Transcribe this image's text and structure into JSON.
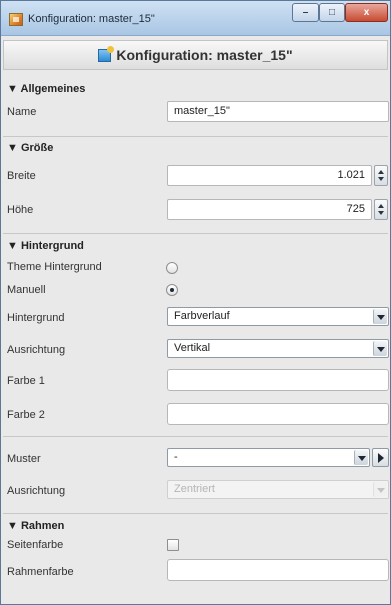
{
  "window": {
    "title": "Konfiguration: master_15\"",
    "buttons": {
      "minimize": "–",
      "maximize": "□",
      "close": "x"
    }
  },
  "panel": {
    "header": "Konfiguration: master_15\""
  },
  "sections": {
    "allgemeines": {
      "title": "▼ Allgemeines",
      "name_label": "Name",
      "name_value": "master_15\""
    },
    "groesse": {
      "title": "▼ Größe",
      "breite_label": "Breite",
      "breite_value": "1.021",
      "hoehe_label": "Höhe",
      "hoehe_value": "725"
    },
    "hintergrund": {
      "title": "▼ Hintergrund",
      "theme_label": "Theme Hintergrund",
      "manuell_label": "Manuell",
      "selected_option": "Manuell",
      "hintergrund_label": "Hintergrund",
      "hintergrund_value": "Farbverlauf",
      "ausrichtung_label": "Ausrichtung",
      "ausrichtung_value": "Vertikal",
      "farbe1_label": "Farbe 1",
      "farbe2_label": "Farbe 2",
      "muster_label": "Muster",
      "muster_value": "-",
      "ausrichtung2_label": "Ausrichtung",
      "ausrichtung2_value": "Zentriert"
    },
    "rahmen": {
      "title": "▼ Rahmen",
      "seitenfarbe_label": "Seitenfarbe",
      "seitenfarbe_checked": false,
      "rahmenfarbe_label": "Rahmenfarbe"
    }
  },
  "colors": {
    "accent": "#a9c6e4",
    "close_button": "#c84b32"
  }
}
